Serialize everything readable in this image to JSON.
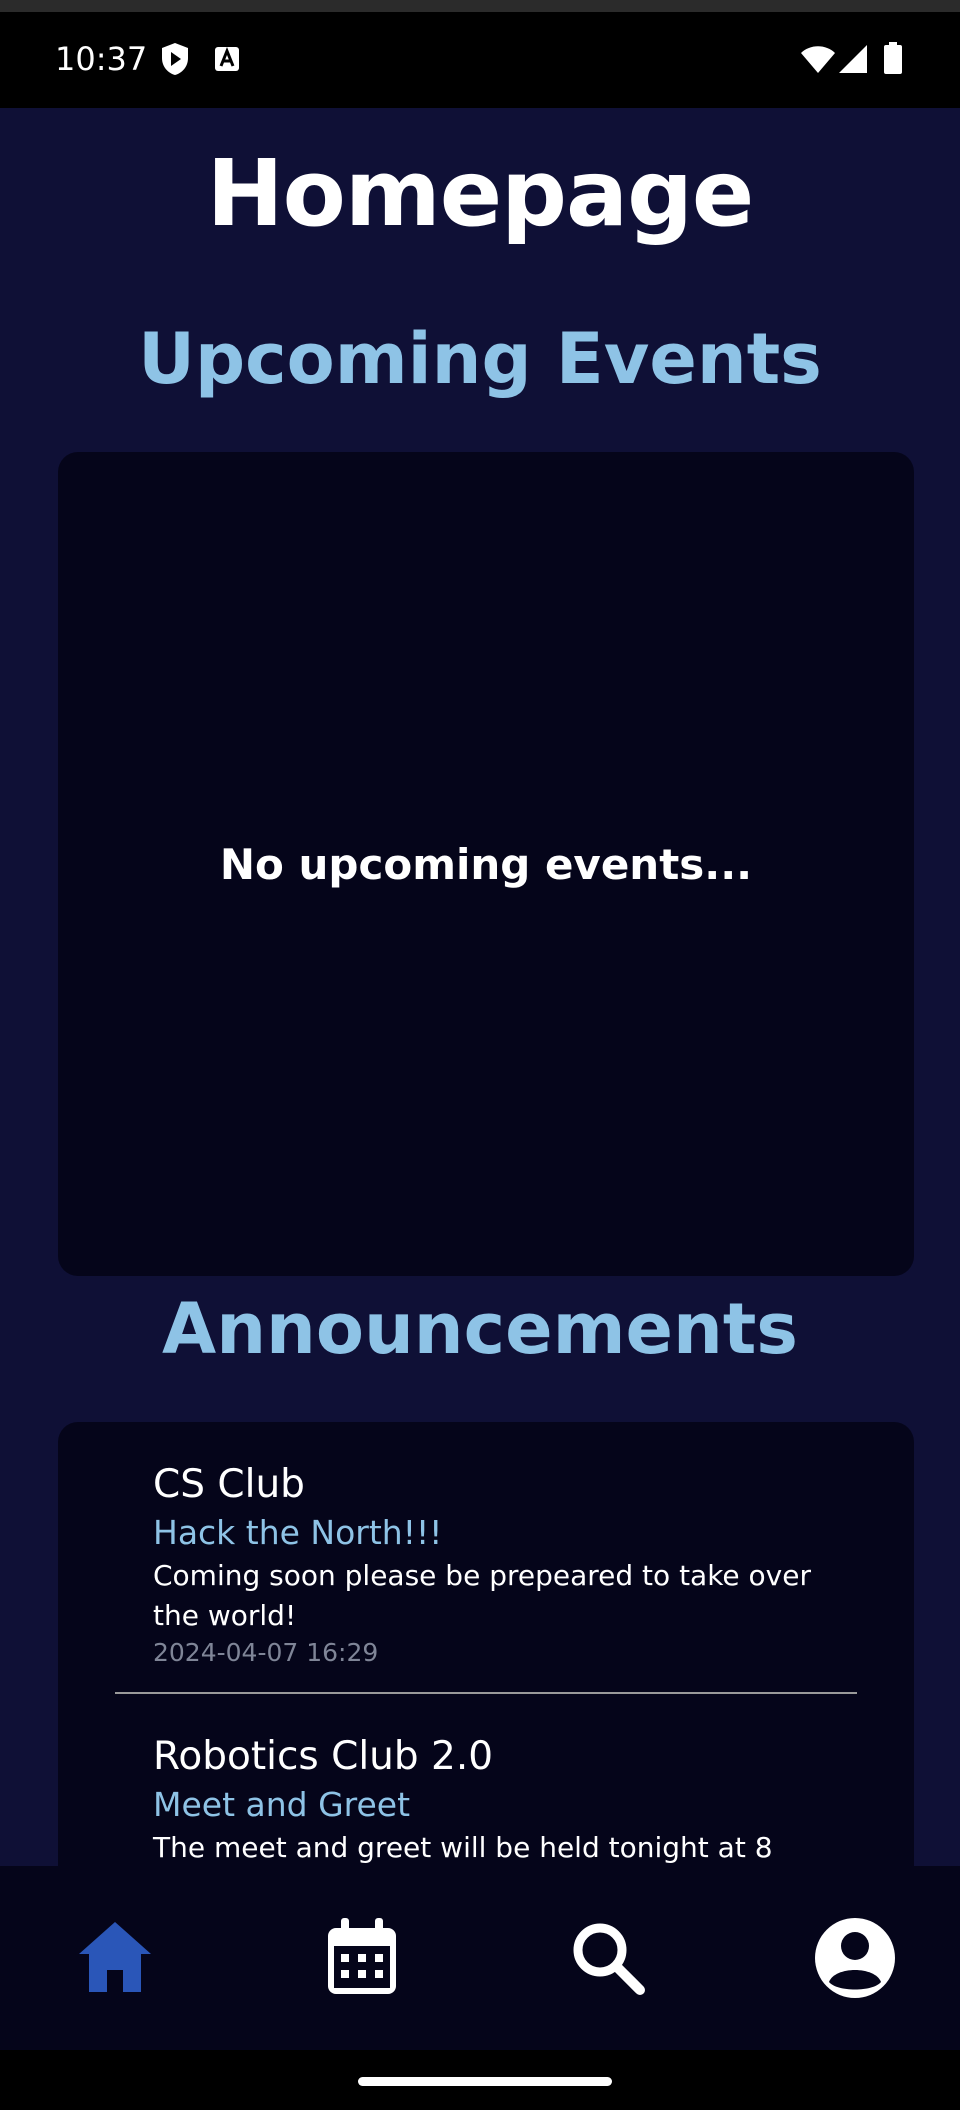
{
  "status_bar": {
    "time": "10:37",
    "left_icons": [
      "shield-play-icon",
      "a-box-icon"
    ],
    "right_icons": [
      "wifi-icon",
      "signal-icon",
      "battery-icon"
    ]
  },
  "page": {
    "title": "Homepage"
  },
  "upcoming_events": {
    "heading": "Upcoming Events",
    "empty_message": "No upcoming events..."
  },
  "announcements": {
    "heading": "Announcements",
    "items": [
      {
        "club": "CS Club",
        "title": "Hack the North!!!",
        "body": "Coming soon please be prepeared to take over the world!",
        "date": "2024-04-07 16:29"
      },
      {
        "club": "Robotics Club 2.0",
        "title": "Meet and Greet",
        "body": "The meet and greet will be held tonight at 8"
      }
    ]
  },
  "bottom_nav": {
    "items": [
      "home-icon",
      "calendar-icon",
      "search-icon",
      "profile-icon"
    ],
    "active_index": 0
  },
  "colors": {
    "background": "#0f1036",
    "card": "#05051a",
    "accent": "#8ec3e6",
    "active_nav": "#2a56b8"
  }
}
